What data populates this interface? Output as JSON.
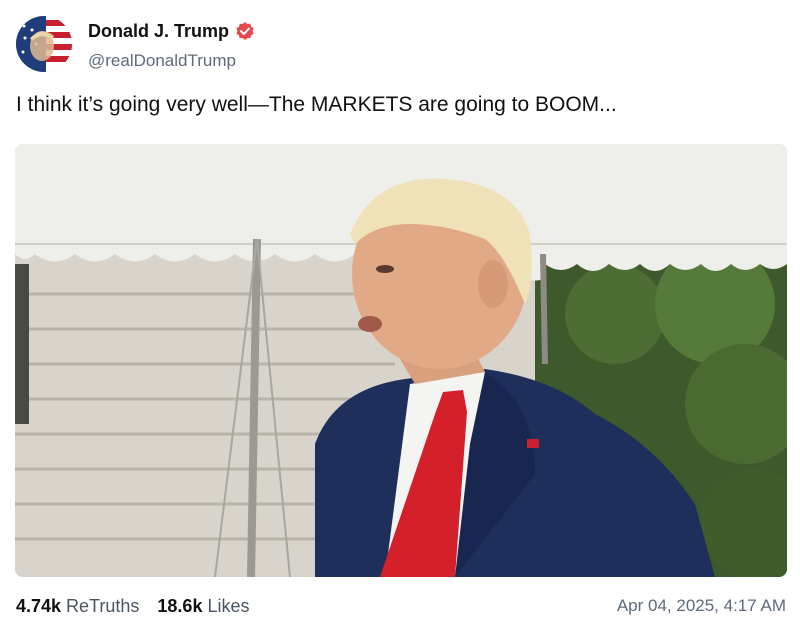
{
  "author": {
    "display_name": "Donald J. Trump",
    "handle": "@realDonaldTrump",
    "verified_icon": "verified-badge-icon",
    "badge_color": "#e5484d"
  },
  "post": {
    "text": "I think it’s going very well—The MARKETS are going to BOOM..."
  },
  "stats": {
    "retruths_count": "4.74k",
    "retruths_label": "ReTruths",
    "likes_count": "18.6k",
    "likes_label": "Likes"
  },
  "timestamp": "Apr 04, 2025, 4:17 AM"
}
